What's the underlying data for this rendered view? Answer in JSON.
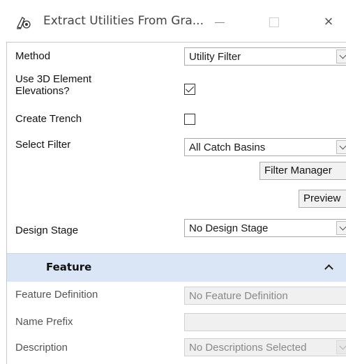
{
  "window": {
    "title": "Extract Utilities From Gra...",
    "app_icon": "utility-tool-icon",
    "controls": {
      "minimize": "minimize",
      "maximize": "maximize",
      "close": "×"
    }
  },
  "form": {
    "method": {
      "label": "Method",
      "value": "Utility Filter"
    },
    "use_3d": {
      "label_line1": "Use 3D Element",
      "label_line2": "Elevations?",
      "checked": true
    },
    "create_trench": {
      "label": "Create Trench",
      "checked": false
    },
    "select_filter": {
      "label": "Select Filter",
      "value": "All Catch Basins"
    },
    "filter_manager_label": "Filter Manager",
    "preview_label": "Preview",
    "design_stage": {
      "label": "Design Stage",
      "value": "No Design Stage"
    }
  },
  "feature_section": {
    "title": "Feature",
    "collapse_icon": "chevron-up-icon",
    "header_color": "#dae6f5",
    "feature_definition": {
      "label": "Feature Definition",
      "value": "No Feature Definition"
    },
    "name_prefix": {
      "label": "Name Prefix",
      "value": ""
    },
    "description": {
      "label": "Description",
      "value": "No Descriptions Selected"
    }
  }
}
